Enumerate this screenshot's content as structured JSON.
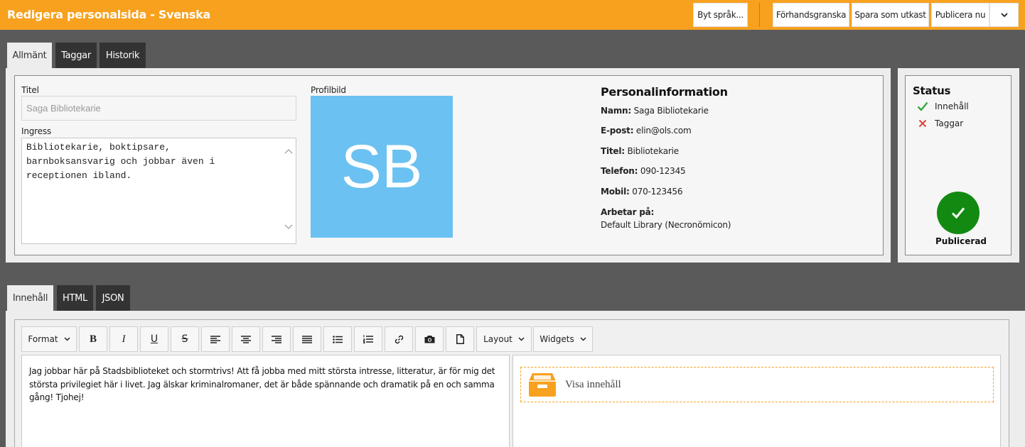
{
  "header": {
    "title": "Redigera personalsida - Svenska",
    "buttons": {
      "change_language": "Byt språk...",
      "preview": "Förhandsgranska",
      "save_draft": "Spara som utkast",
      "publish": "Publicera nu"
    }
  },
  "top_tabs": [
    {
      "label": "Allmänt",
      "active": true
    },
    {
      "label": "Taggar",
      "active": false
    },
    {
      "label": "Historik",
      "active": false
    }
  ],
  "general": {
    "title_label": "Titel",
    "title_placeholder": "Saga Bibliotekarie",
    "lead_label": "Ingress",
    "lead_value": "Bibliotekarie, boktipsare,\nbarnboksansvarig och jobbar även i\nreceptionen ibland.",
    "profile_label": "Profilbild",
    "avatar_initials": "SB",
    "avatar_color": "#6bc1f1"
  },
  "personal_info": {
    "heading": "Personalinformation",
    "name_label": "Namn:",
    "name_value": "Saga Bibliotekarie",
    "email_label": "E-post:",
    "email_value": "elin@ols.com",
    "title_label": "Titel:",
    "title_value": "Bibliotekarie",
    "phone_label": "Telefon:",
    "phone_value": "090-12345",
    "mobile_label": "Mobil:",
    "mobile_value": "070-123456",
    "works_label": "Arbetar på:",
    "works_value": "Default Library (Necronömicon)"
  },
  "status": {
    "heading": "Status",
    "items": [
      {
        "label": "Innehåll",
        "ok": true
      },
      {
        "label": "Taggar",
        "ok": false
      }
    ],
    "published_label": "Publicerad",
    "published_color": "#128a12"
  },
  "content_tabs": [
    {
      "label": "Innehåll",
      "active": true
    },
    {
      "label": "HTML",
      "active": false
    },
    {
      "label": "JSON",
      "active": false
    }
  ],
  "toolbar": {
    "format": "Format",
    "layout": "Layout",
    "widgets": "Widgets"
  },
  "editor": {
    "body": "Jag jobbar här på Stadsbiblioteket och stormtrivs! Att få jobba med mitt största intresse, litteratur, är för mig det största privilegiet här i livet. Jag älskar kriminalromaner, det är både spännande och dramatik på en och samma gång! Tjohej!",
    "widget_label": "Visa innehåll"
  },
  "colors": {
    "accent": "#f7a11e",
    "ok": "#3aa83a",
    "error": "#d9433b"
  }
}
